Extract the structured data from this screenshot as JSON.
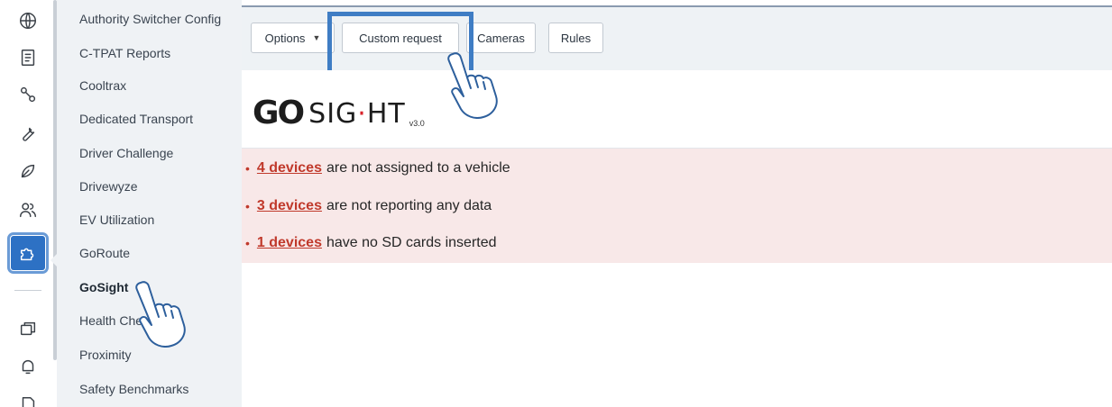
{
  "rail": {
    "icons": [
      "globe-icon",
      "receipt-icon",
      "route-icon",
      "wrench-icon",
      "leaf-icon",
      "users-icon",
      "puzzle-icon",
      "windows-icon",
      "bell-icon",
      "document-icon"
    ],
    "active_icon": "puzzle-icon",
    "accent_color": "#2d71c4"
  },
  "submenu": {
    "items": [
      "Authority Switcher Config",
      "C-TPAT Reports",
      "Cooltrax",
      "Dedicated Transport",
      "Driver Challenge",
      "Drivewyze",
      "EV Utilization",
      "GoRoute",
      "GoSight",
      "Health Che",
      "Proximity",
      "Safety Benchmarks"
    ],
    "active_item": "GoSight"
  },
  "toolbar": {
    "options_label": "Options",
    "custom_request_label": "Custom request",
    "cameras_label": "Cameras",
    "rules_label": "Rules"
  },
  "logo": {
    "go": "GO",
    "sight": "SIGHT",
    "version": "v3.0"
  },
  "alerts": [
    {
      "link": "4 devices",
      "text": "are not assigned to a vehicle"
    },
    {
      "link": "3 devices",
      "text": "are not reporting any data"
    },
    {
      "link": "1 devices",
      "text": "have no SD cards inserted"
    }
  ],
  "colors": {
    "alert_bg": "#f8e8e8",
    "alert_link": "#c0392b",
    "highlight": "#3f7dc4"
  }
}
